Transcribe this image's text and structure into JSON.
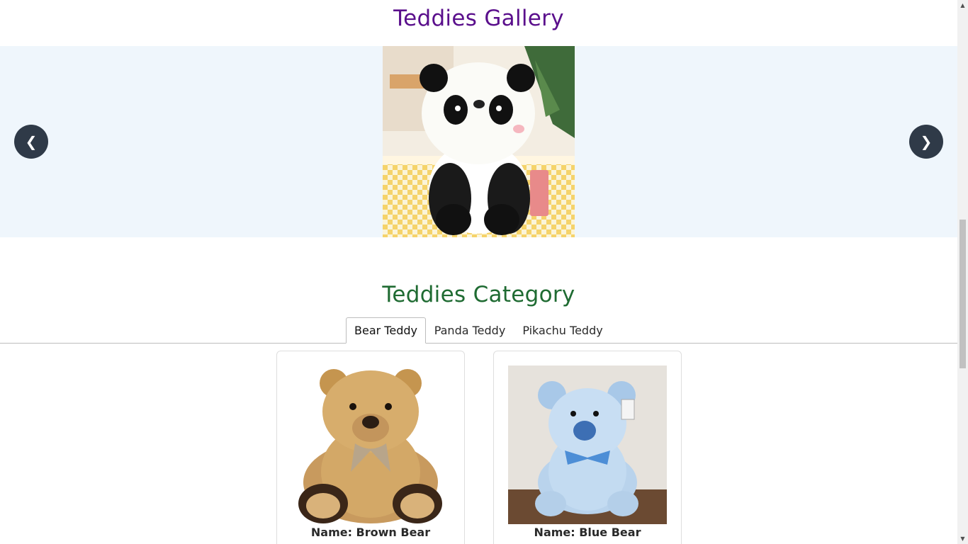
{
  "gallery": {
    "title": "Teddies Gallery",
    "prev_label": "❮",
    "next_label": "❯"
  },
  "category": {
    "title": "Teddies Category",
    "tabs": [
      {
        "label": "Bear Teddy",
        "active": true
      },
      {
        "label": "Panda Teddy",
        "active": false
      },
      {
        "label": "Pikachu Teddy",
        "active": false
      }
    ]
  },
  "cards": [
    {
      "name": "Name: Brown Bear"
    },
    {
      "name": "Name: Blue Bear"
    }
  ],
  "colors": {
    "gallery_title": "#5a0f8c",
    "category_title": "#1f6b32",
    "carousel_bg": "#eff6fc",
    "nav_button": "#2f3a48"
  },
  "scrollbar": {
    "up_icon": "▲",
    "down_icon": "▼"
  }
}
